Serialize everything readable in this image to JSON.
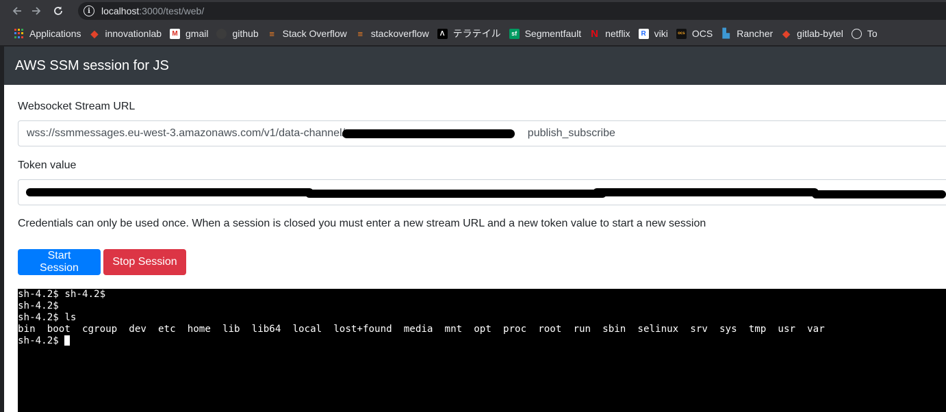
{
  "browser": {
    "url_host": "localhost",
    "url_rest": ":3000/test/web/",
    "bookmarks": [
      {
        "label": "Applications",
        "icon": "apps-grid-icon"
      },
      {
        "label": "innovationlab",
        "icon": "gitlab-icon"
      },
      {
        "label": "gmail",
        "icon": "gmail-icon"
      },
      {
        "label": "github",
        "icon": "github-icon"
      },
      {
        "label": "Stack Overflow",
        "icon": "stackoverflow-icon"
      },
      {
        "label": "stackoverflow",
        "icon": "stackoverflow-icon"
      },
      {
        "label": "テラテイル",
        "icon": "teratail-icon"
      },
      {
        "label": "Segmentfault",
        "icon": "segmentfault-icon"
      },
      {
        "label": "netflix",
        "icon": "netflix-icon"
      },
      {
        "label": "viki",
        "icon": "viki-icon"
      },
      {
        "label": "OCS",
        "icon": "ocs-icon"
      },
      {
        "label": "Rancher",
        "icon": "rancher-icon"
      },
      {
        "label": "gitlab-bytel",
        "icon": "gitlab-icon"
      },
      {
        "label": "To",
        "icon": "globe-icon"
      }
    ]
  },
  "app": {
    "title": "AWS SSM session for JS",
    "stream_label": "Websocket Stream URL",
    "stream_value": "wss://ssmmessages.eu-west-3.amazonaws.com/v1/data-channel/                                                            publish_subscribe",
    "token_label": "Token value",
    "note": "Credentials can only be used once. When a session is closed you must enter a new stream URL and a new token value to start a new session",
    "start_label": "Start Session",
    "stop_label": "Stop Session"
  },
  "terminal": {
    "lines": [
      "sh-4.2$ sh-4.2$",
      "sh-4.2$",
      "sh-4.2$ ls",
      "bin  boot  cgroup  dev  etc  home  lib  lib64  local  lost+found  media  mnt  opt  proc  root  run  sbin  selinux  srv  sys  tmp  usr  var",
      "sh-4.2$ "
    ]
  },
  "colors": {
    "primary": "#007bff",
    "danger": "#dc3545",
    "navbar": "#343a40",
    "terminal_bg": "#000000"
  }
}
